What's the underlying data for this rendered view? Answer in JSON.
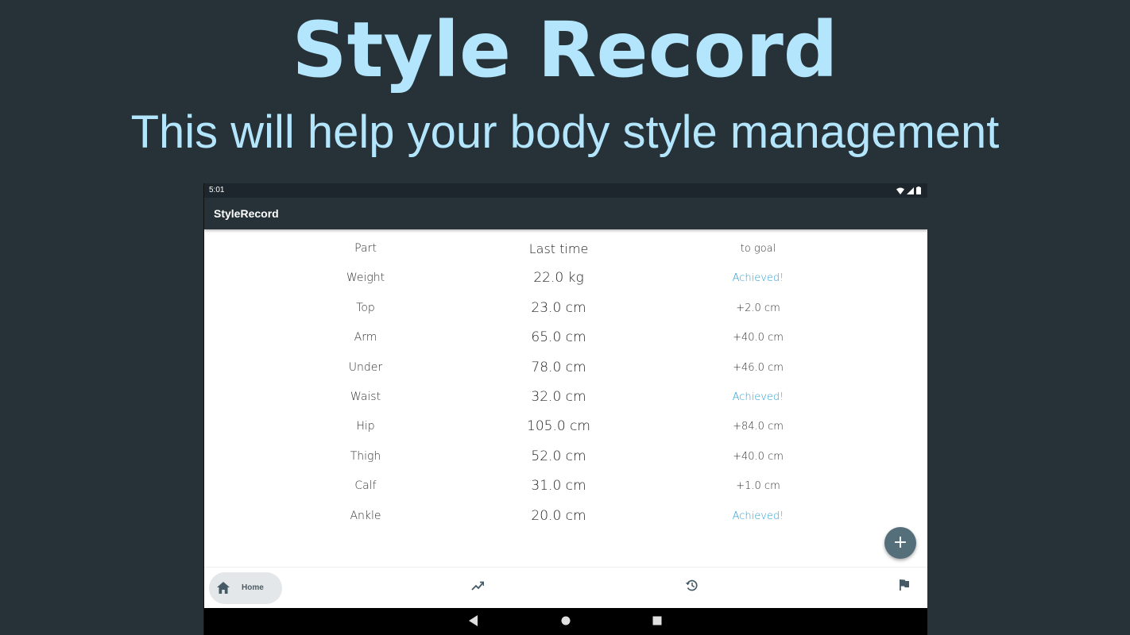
{
  "promo": {
    "title": "Style Record",
    "subtitle": "This will help your body style management"
  },
  "status_bar": {
    "time": "5:01",
    "icons": [
      "wifi-icon",
      "signal-icon",
      "battery-icon"
    ]
  },
  "app_bar": {
    "title": "StyleRecord"
  },
  "table": {
    "headers": {
      "part": "Part",
      "last_time": "Last time",
      "to_goal": "to goal"
    },
    "rows": [
      {
        "part": "Weight",
        "last_time": "22.0 kg",
        "to_goal": "Achieved!",
        "achieved": true
      },
      {
        "part": "Top",
        "last_time": "23.0 cm",
        "to_goal": "+2.0 cm",
        "achieved": false
      },
      {
        "part": "Arm",
        "last_time": "65.0 cm",
        "to_goal": "+40.0 cm",
        "achieved": false
      },
      {
        "part": "Under",
        "last_time": "78.0 cm",
        "to_goal": "+46.0 cm",
        "achieved": false
      },
      {
        "part": "Waist",
        "last_time": "32.0 cm",
        "to_goal": "Achieved!",
        "achieved": true
      },
      {
        "part": "Hip",
        "last_time": "105.0 cm",
        "to_goal": "+84.0 cm",
        "achieved": false
      },
      {
        "part": "Thigh",
        "last_time": "52.0 cm",
        "to_goal": "+40.0 cm",
        "achieved": false
      },
      {
        "part": "Calf",
        "last_time": "31.0 cm",
        "to_goal": "+1.0 cm",
        "achieved": false
      },
      {
        "part": "Ankle",
        "last_time": "20.0 cm",
        "to_goal": "Achieved!",
        "achieved": true
      }
    ]
  },
  "fab": {
    "label": "+",
    "icon": "add-icon"
  },
  "bottom_nav": {
    "items": [
      {
        "id": "home",
        "label": "Home",
        "icon": "home-icon",
        "selected": true
      },
      {
        "id": "graph",
        "label": "",
        "icon": "trending-up-icon",
        "selected": false
      },
      {
        "id": "history",
        "label": "",
        "icon": "history-icon",
        "selected": false
      },
      {
        "id": "goal",
        "label": "",
        "icon": "flag-icon",
        "selected": false
      }
    ]
  },
  "system_nav": {
    "icons": [
      "back-icon",
      "home-circle-icon",
      "recents-icon"
    ]
  },
  "colors": {
    "background": "#263238",
    "promo_text": "#b3e5fc",
    "app_bar": "#263238",
    "achieved": "#29a0d8",
    "fab": "#546e7a",
    "nav_selected_bg": "#e3e7ea"
  }
}
